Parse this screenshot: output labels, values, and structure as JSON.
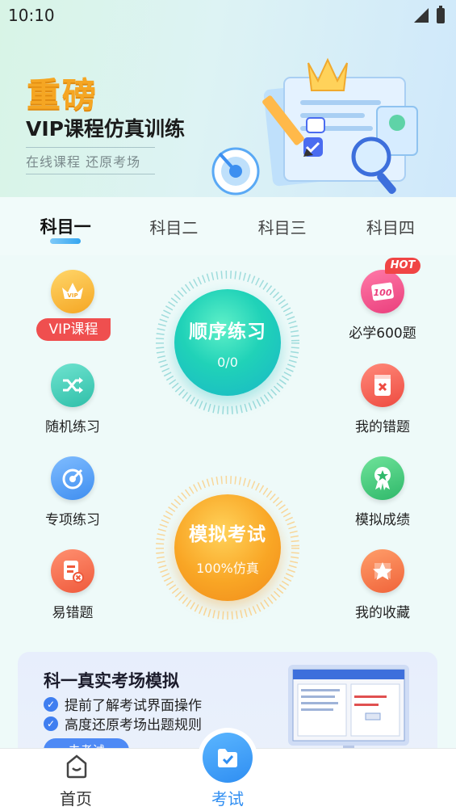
{
  "status_bar": {
    "time": "10:10"
  },
  "banner": {
    "headline": "重磅",
    "title": "VIP课程仿真训练",
    "subtitle": "在线课程  还原考场"
  },
  "tabs": [
    {
      "label": "科目一",
      "active": true
    },
    {
      "label": "科目二",
      "active": false
    },
    {
      "label": "科目三",
      "active": false
    },
    {
      "label": "科目四",
      "active": false
    }
  ],
  "left_items": [
    {
      "label": "VIP课程",
      "icon": "vip-crown-icon",
      "color": "#f7b733"
    },
    {
      "label": "随机练习",
      "icon": "shuffle-icon",
      "color": "#3fcfb8"
    },
    {
      "label": "专项练习",
      "icon": "target-icon",
      "color": "#4a9cf5"
    },
    {
      "label": "易错题",
      "icon": "error-doc-icon",
      "color": "#f26b4a"
    }
  ],
  "right_items": [
    {
      "label": "必学600题",
      "icon": "score-100-icon",
      "color": "#f0508a",
      "badge": "HOT"
    },
    {
      "label": "我的错题",
      "icon": "wrong-answer-icon",
      "color": "#f25a4a"
    },
    {
      "label": "模拟成绩",
      "icon": "medal-icon",
      "color": "#3fc97a"
    },
    {
      "label": "我的收藏",
      "icon": "star-icon",
      "color": "#f27a45"
    }
  ],
  "center": {
    "practice": {
      "title": "顺序练习",
      "progress": "0/0",
      "color": "#2bcfbf"
    },
    "exam": {
      "title": "模拟考试",
      "note": "100%仿真",
      "color": "#f7a528"
    }
  },
  "promo": {
    "title": "科一真实考场模拟",
    "points": [
      "提前了解考试界面操作",
      "高度还原考场出题规则"
    ],
    "button": "去考试"
  },
  "bottom_nav": {
    "home": "首页",
    "exam": "考试"
  }
}
